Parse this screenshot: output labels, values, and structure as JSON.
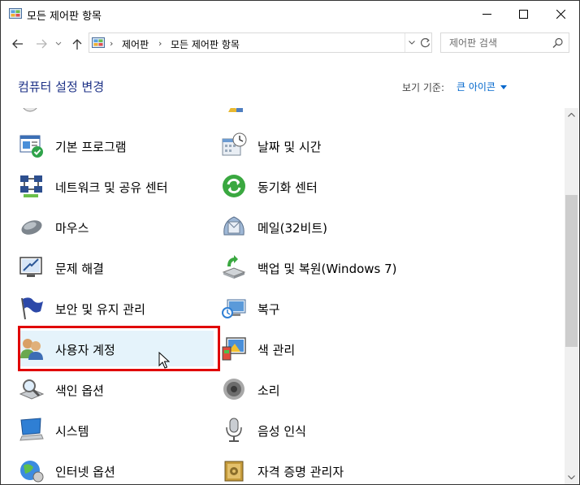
{
  "window": {
    "title": "모든 제어판 항목"
  },
  "address": {
    "breadcrumb": [
      "제어판",
      "모든 제어판 항목"
    ]
  },
  "search": {
    "placeholder": "제어판 검색"
  },
  "header": {
    "heading": "컴퓨터 설정 변경",
    "view_label": "보기 기준:",
    "view_value": "큰 아이콘"
  },
  "items_left": [
    {
      "label": "기본 프로그램",
      "icon": "default-programs-icon"
    },
    {
      "label": "네트워크 및 공유 센터",
      "icon": "network-sharing-icon"
    },
    {
      "label": "마우스",
      "icon": "mouse-icon"
    },
    {
      "label": "문제 해결",
      "icon": "troubleshooting-icon"
    },
    {
      "label": "보안 및 유지 관리",
      "icon": "flag-icon"
    },
    {
      "label": "사용자 계정",
      "icon": "user-accounts-icon"
    },
    {
      "label": "색인 옵션",
      "icon": "indexing-icon"
    },
    {
      "label": "시스템",
      "icon": "system-icon"
    },
    {
      "label": "인터넷 옵션",
      "icon": "internet-options-icon"
    }
  ],
  "items_right": [
    {
      "label": "날짜 및 시간",
      "icon": "date-time-icon"
    },
    {
      "label": "동기화 센터",
      "icon": "sync-center-icon"
    },
    {
      "label": "메일(32비트)",
      "icon": "mail-icon"
    },
    {
      "label": "백업 및 복원(Windows 7)",
      "icon": "backup-restore-icon"
    },
    {
      "label": "복구",
      "icon": "recovery-icon"
    },
    {
      "label": "색 관리",
      "icon": "color-management-icon"
    },
    {
      "label": "소리",
      "icon": "sound-icon"
    },
    {
      "label": "음성 인식",
      "icon": "speech-recognition-icon"
    },
    {
      "label": "자격 증명 관리자",
      "icon": "credential-manager-icon"
    }
  ],
  "colors": {
    "heading": "#1e3287",
    "link": "#0066cc",
    "hover": "#e5f3fb",
    "highlight_border": "#e00000"
  }
}
